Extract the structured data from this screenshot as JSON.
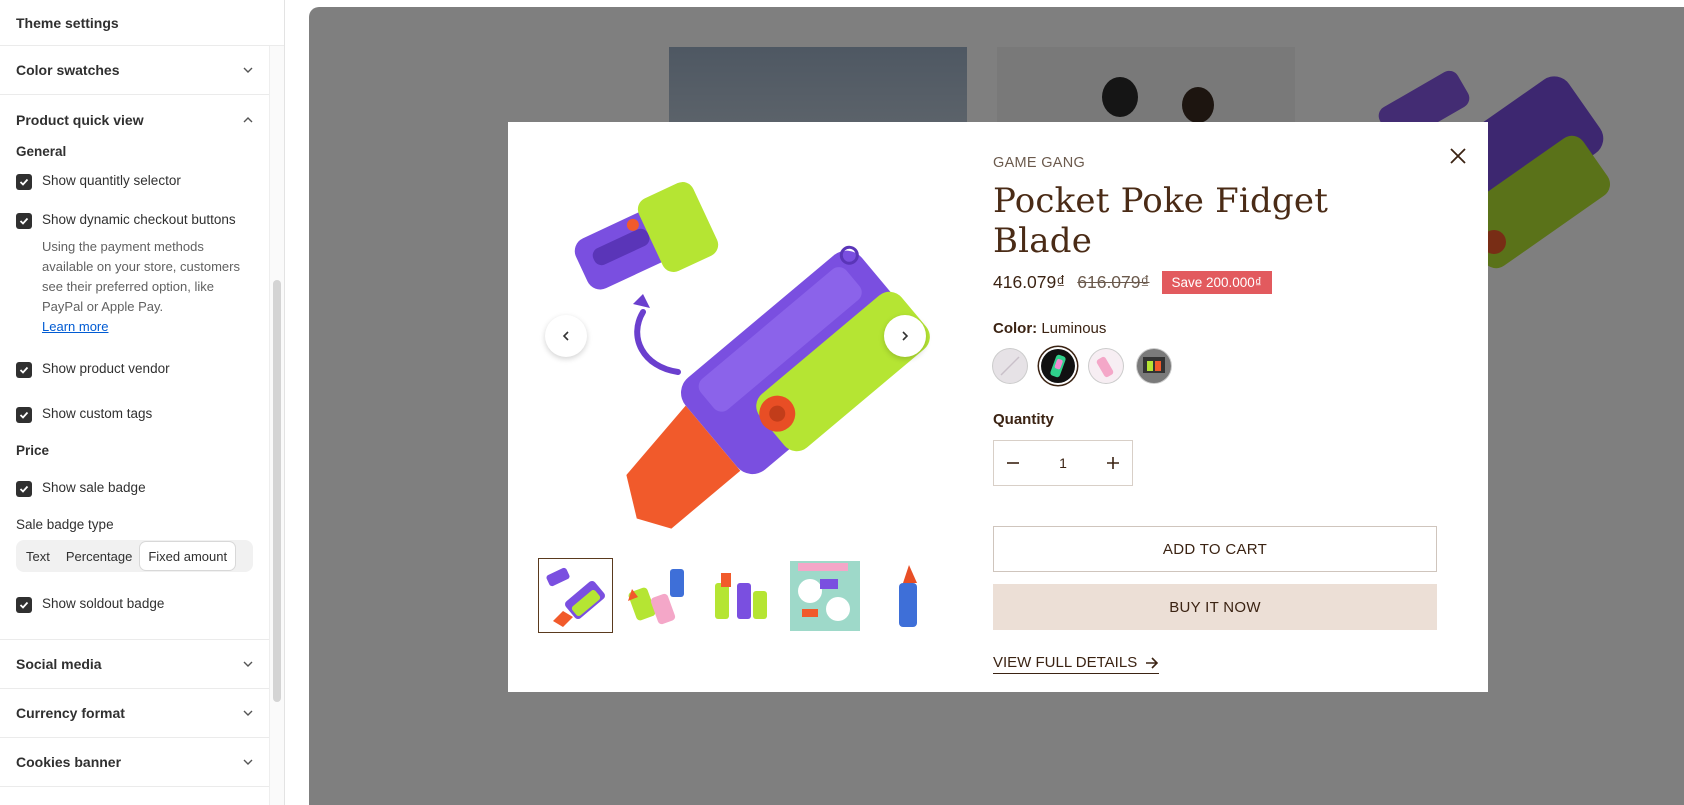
{
  "sidebar": {
    "title": "Theme settings",
    "sections": {
      "color_swatches": "Color swatches",
      "product_quick_view": "Product quick view",
      "social_media": "Social media",
      "currency_format": "Currency format",
      "cookies_banner": "Cookies banner"
    },
    "quick_view": {
      "general_heading": "General",
      "show_quantity_selector": "Show quantitly selector",
      "show_dynamic_checkout": "Show dynamic checkout buttons",
      "dynamic_help": "Using the payment methods available on your store, customers see their preferred option, like PayPal or Apple Pay.",
      "learn_more": "Learn more",
      "show_product_vendor": "Show product vendor",
      "show_custom_tags": "Show custom tags",
      "price_heading": "Price",
      "show_sale_badge": "Show sale badge",
      "sale_badge_type_label": "Sale badge type",
      "sale_badge_options": [
        "Text",
        "Percentage",
        "Fixed amount"
      ],
      "sale_badge_selected": "Fixed amount",
      "show_soldout_badge": "Show soldout badge"
    }
  },
  "modal": {
    "vendor": "GAME GANG",
    "title": "Pocket Poke Fidget Blade",
    "price": "416.079₫",
    "compare_price": "616.079₫",
    "save_badge": "Save 200.000₫",
    "color_label": "Color:",
    "color_value": "Luminous",
    "quantity_label": "Quantity",
    "quantity_value": "1",
    "add_to_cart": "ADD TO CART",
    "buy_it_now": "BUY IT NOW",
    "view_full_details": "VIEW FULL DETAILS"
  },
  "colors": {
    "purple": "#7a4fe0",
    "lime": "#b5e533",
    "orange": "#f15a2b",
    "sale": "#e25a5e",
    "brown": "#3b2313"
  }
}
